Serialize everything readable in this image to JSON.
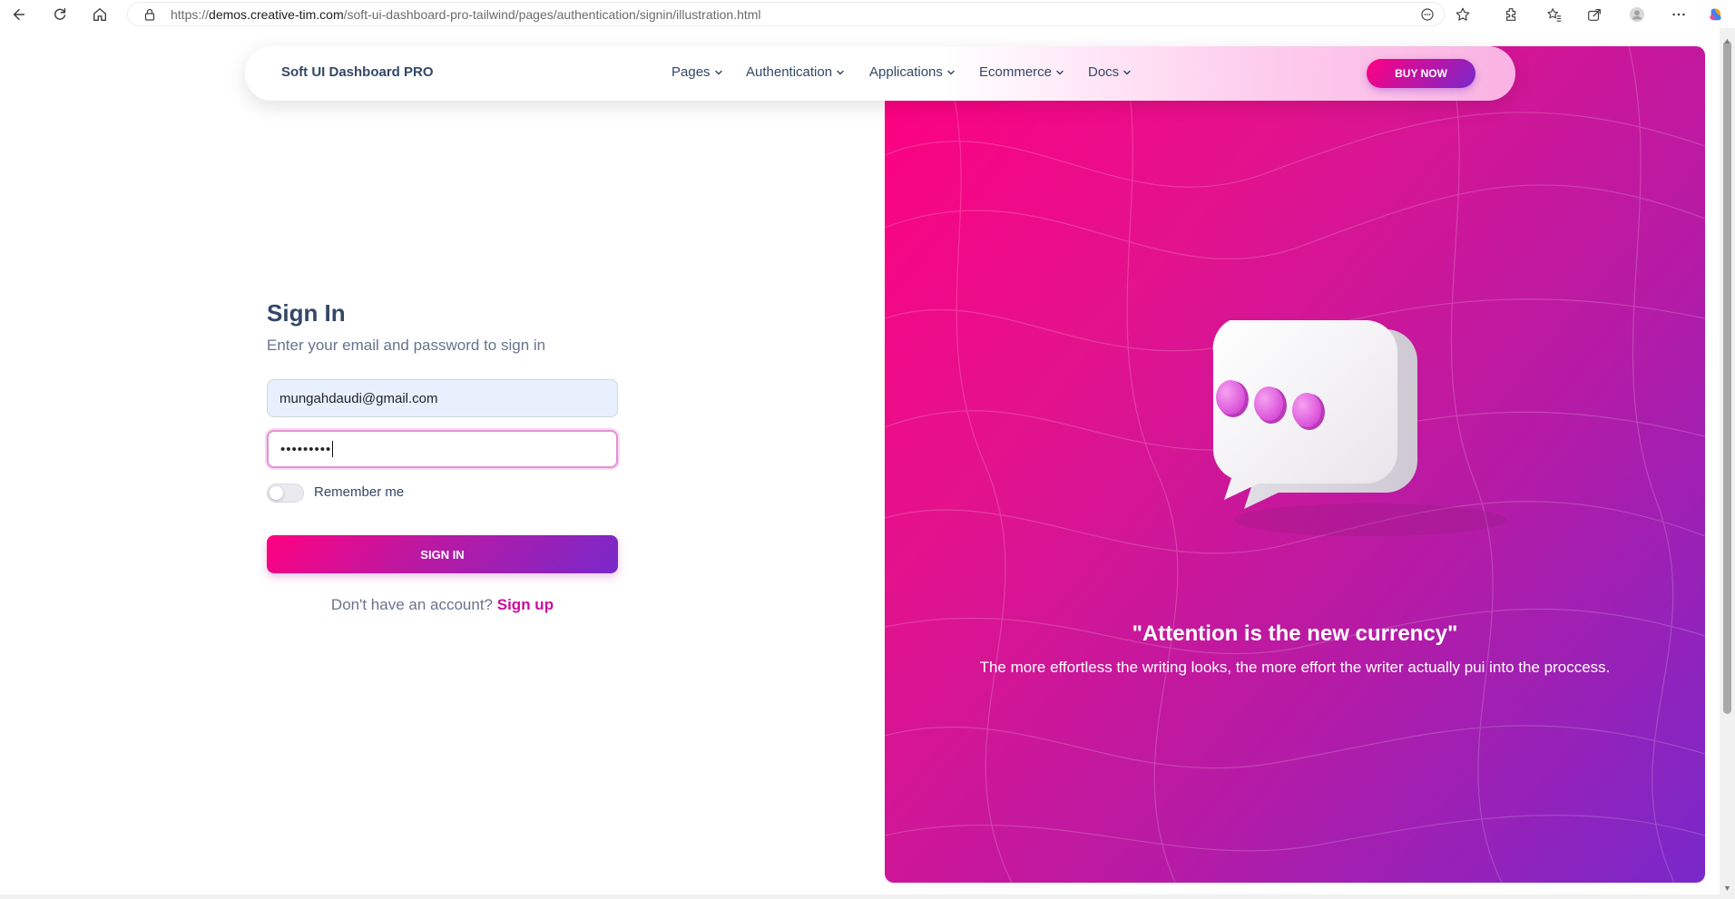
{
  "browser": {
    "url_prefix": "https://",
    "url_host": "demos.creative-tim.com",
    "url_path": "/soft-ui-dashboard-pro-tailwind/pages/authentication/signin/illustration.html"
  },
  "navbar": {
    "brand": "Soft UI Dashboard PRO",
    "items": [
      {
        "label": "Pages"
      },
      {
        "label": "Authentication"
      },
      {
        "label": "Applications"
      },
      {
        "label": "Ecommerce"
      },
      {
        "label": "Docs"
      }
    ],
    "buy_now": "BUY NOW"
  },
  "signin": {
    "title": "Sign In",
    "subtitle": "Enter your email and password to sign in",
    "email_value": "mungahdaudi@gmail.com",
    "password_masked": "•••••••••",
    "remember_label": "Remember me",
    "remember_checked": false,
    "button_label": "SIGN IN",
    "no_account_text": "Don't have an account?",
    "signup_link": "Sign up"
  },
  "hero": {
    "quote": "\"Attention is the new currency\"",
    "caption": "The more effortless the writing looks, the more effort the writer actually pui into the proccess."
  },
  "colors": {
    "gradient_start": "#FF0080",
    "gradient_end": "#7928CA",
    "text_dark": "#344767",
    "text_muted": "#67748e",
    "link": "#cb0c9f"
  },
  "icons": {
    "browser": [
      "back-icon",
      "reload-icon",
      "home-icon",
      "lock-icon",
      "reader-mode-icon",
      "star-icon",
      "extensions-icon",
      "favorites-icon",
      "share-icon",
      "profile-icon",
      "more-icon",
      "copilot-icon"
    ],
    "nav": "chevron-down-icon",
    "illustration": "chat-bubble-icon"
  }
}
